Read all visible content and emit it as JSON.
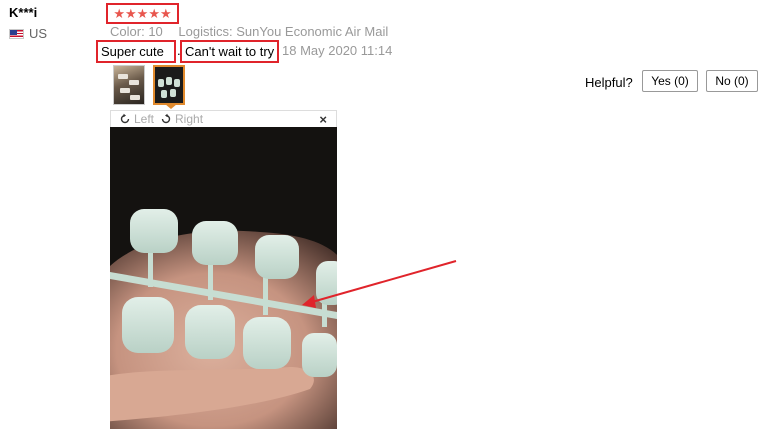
{
  "review": {
    "user_name": "K***i",
    "country": "US",
    "rating": 5,
    "stars": [
      "★",
      "★",
      "★",
      "★",
      "★"
    ],
    "color_label": "Color:",
    "color_value": "10",
    "logistics_label": "Logistics:",
    "logistics_value": "SunYou Economic Air Mail",
    "text_part1": "Super cute",
    "separator": ".",
    "text_part2": "Can't wait to try",
    "date": "18 May 2020 11:14"
  },
  "viewer": {
    "rotate_left": "Left",
    "rotate_right": "Right",
    "close": "×"
  },
  "helpful": {
    "label": "Helpful?",
    "yes": "Yes (0)",
    "no": "No (0)"
  },
  "colors": {
    "highlight": "#e0242b",
    "star": "#e8564e",
    "thumb_active": "#e18a2d",
    "meta_text": "#999999"
  },
  "icons": [
    "flag-us-icon",
    "star-icon",
    "rotate-left-icon",
    "rotate-right-icon",
    "close-icon",
    "annotation-arrow"
  ]
}
